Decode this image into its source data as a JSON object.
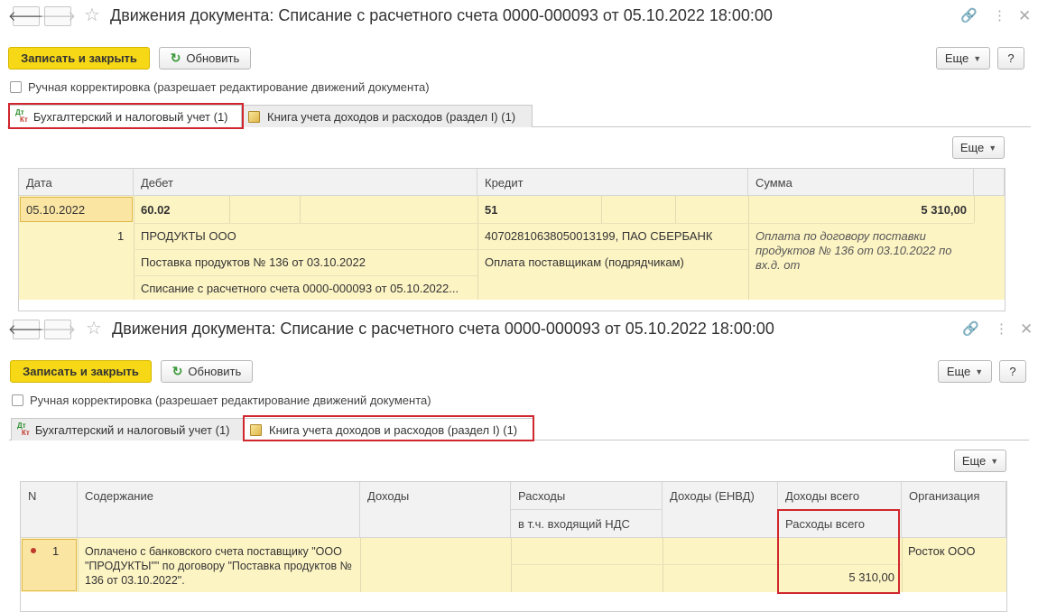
{
  "window1": {
    "title": "Движения документа: Списание с расчетного счета 0000-000093 от 05.10.2022 18:00:00",
    "nav": {
      "back_icon": "arrow-left-icon",
      "forward_icon": "arrow-right-icon",
      "star_icon": "star-icon"
    },
    "toolbar": {
      "save_close": "Записать и закрыть",
      "refresh": "Обновить",
      "more": "Еще",
      "help": "?"
    },
    "manual_edit": "Ручная корректировка (разрешает редактирование движений документа)",
    "tabs": [
      "Бухгалтерский и налоговый учет (1)",
      "Книга учета доходов и расходов (раздел I) (1)"
    ],
    "tab_icon_text": {
      "dt": "Дт",
      "kt": "Кт"
    },
    "table_more": "Еще",
    "columns": [
      "Дата",
      "Дебет",
      "Кредит",
      "Сумма"
    ],
    "row": {
      "date": "05.10.2022",
      "number": "1",
      "debit_account": "60.02",
      "debit_sub1": "ПРОДУКТЫ ООО",
      "debit_sub2": "Поставка продуктов № 136 от 03.10.2022",
      "debit_sub3": "Списание с расчетного счета 0000-000093 от 05.10.2022...",
      "credit_account": "51",
      "credit_sub1": "40702810638050013199, ПАО СБЕРБАНК",
      "credit_sub2": "Оплата поставщикам (подрядчикам)",
      "amount": "5 310,00",
      "description": "Оплата по договору поставки продуктов № 136 от 03.10.2022 по вх.д.  от"
    }
  },
  "window2": {
    "title": "Движения документа: Списание с расчетного счета 0000-000093 от 05.10.2022 18:00:00",
    "toolbar": {
      "save_close": "Записать и закрыть",
      "refresh": "Обновить",
      "more": "Еще",
      "help": "?"
    },
    "manual_edit": "Ручная корректировка (разрешает редактирование движений документа)",
    "tabs": [
      "Бухгалтерский и налоговый учет (1)",
      "Книга учета доходов и расходов (раздел I) (1)"
    ],
    "tab_icon_text": {
      "dt": "Дт",
      "kt": "Кт"
    },
    "table_more": "Еще",
    "columns": {
      "n": "N",
      "content": "Содержание",
      "income": "Доходы",
      "expenses": "Расходы",
      "expenses_vat": "в т.ч. входящий НДС",
      "income_envd": "Доходы (ЕНВД)",
      "income_total": "Доходы всего",
      "expenses_total": "Расходы всего",
      "organization": "Организация"
    },
    "row": {
      "n": "1",
      "content": "Оплачено с банковского счета поставщику \"ООО \"ПРОДУКТЫ\"\" по договору \"Поставка продуктов № 136 от 03.10.2022\".",
      "expenses_total": "5 310,00",
      "organization": "Росток ООО"
    }
  },
  "colors": {
    "accent_yellow": "#f7d816",
    "highlight_red": "#d0262d",
    "row_bg": "#fdf4c4"
  },
  "icons": {
    "link": "link-icon",
    "menu": "more-vert-icon",
    "close": "close-icon",
    "refresh": "refresh-icon"
  }
}
